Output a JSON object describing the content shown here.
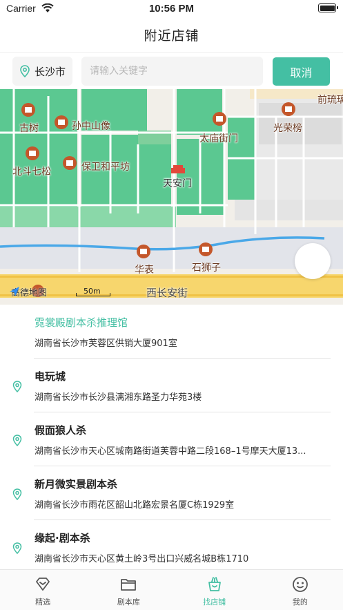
{
  "status_bar": {
    "carrier": "Carrier",
    "time": "10:56 PM"
  },
  "nav": {
    "title": "附近店铺"
  },
  "search": {
    "city": "长沙市",
    "placeholder": "请输入关键字",
    "cancel_label": "取消"
  },
  "map": {
    "pois": [
      "古树",
      "孙中山像",
      "北斗七松",
      "保卫和平坊",
      "太庙街门",
      "光荣榜",
      "前琉璃",
      "天安门",
      "华表",
      "石狮子"
    ],
    "street": "西长安街",
    "logo": "高德地图",
    "scale": "50m"
  },
  "stores": [
    {
      "name": "霓裳殿剧本杀推理馆",
      "address": "湖南省长沙市芙蓉区供销大厦901室"
    },
    {
      "name": "电玩城",
      "address": "湖南省长沙市长沙县漓湘东路圣力华苑3楼"
    },
    {
      "name": "假面狼人杀",
      "address": "湖南省长沙市天心区城南路街道芙蓉中路二段168–1号摩天大厦13..."
    },
    {
      "name": "新月微实景剧本杀",
      "address": "湖南省长沙市雨花区韶山北路宏景名厦C栋1929室"
    },
    {
      "name": "缘起·剧本杀",
      "address": "湖南省长沙市天心区黄土岭3号出口兴威名城B栋1710"
    }
  ],
  "tabs": [
    {
      "label": "精选",
      "icon": "diamond-icon"
    },
    {
      "label": "剧本库",
      "icon": "folder-icon"
    },
    {
      "label": "找店铺",
      "icon": "shop-basket-icon"
    },
    {
      "label": "我的",
      "icon": "smiley-icon"
    }
  ],
  "colors": {
    "accent": "#44bfa3",
    "park": "#5bc891",
    "road": "#ffffff",
    "water": "#4aa8e8",
    "avenue": "#f7d66d",
    "poi": "#c4572b"
  }
}
